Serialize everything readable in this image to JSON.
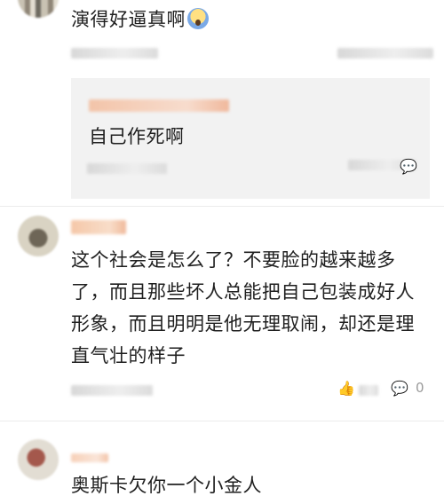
{
  "comments": [
    {
      "text": "演得好逼真啊"
    },
    {
      "reply_text": "自己作死啊"
    },
    {
      "text_lines": [
        "这个社会是怎么了？不要脸的越来越多",
        "了，而且那些坏人总能把自己包装成好人",
        "形象，而且明明是他无理取闹，却还是理",
        "直气壮的样子"
      ],
      "comment_count": "0"
    },
    {
      "text": "奥斯卡欠你一个小金人"
    }
  ],
  "icons": [
    "laughing-face-emoji-icon",
    "like-icon",
    "comment-icon"
  ]
}
